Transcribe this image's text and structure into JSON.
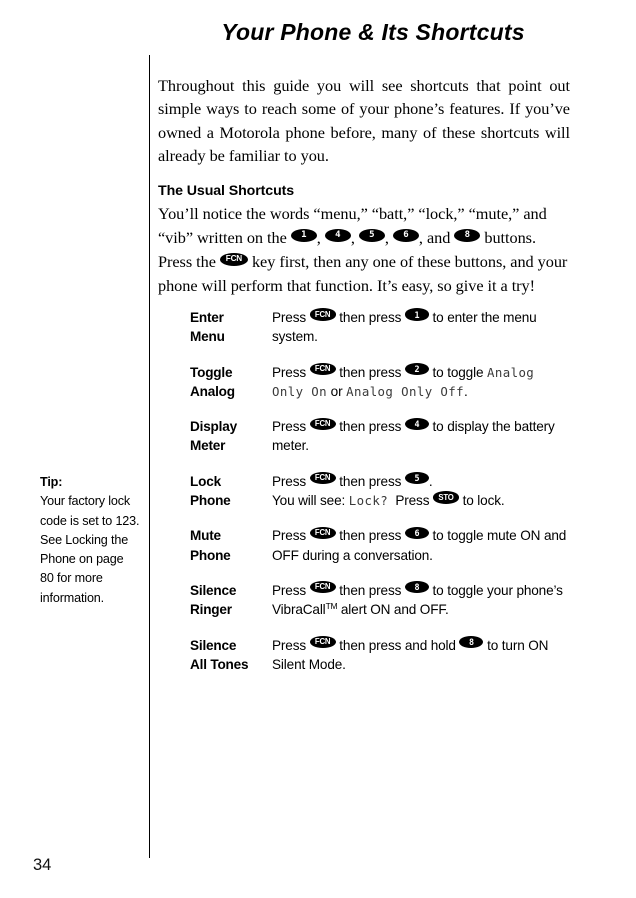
{
  "document": {
    "page_number": "34",
    "title": "Your Phone & Its Shortcuts"
  },
  "intro": {
    "paragraph": "Throughout this guide you will see shortcuts that point out simple ways to reach some of your phone’s features. If you’ve owned a Motorola phone before, many of these shortcuts will already be familiar to you."
  },
  "usual_shortcuts": {
    "heading": "The Usual Shortcuts",
    "text_part_1": "You’ll notice the words “menu,” “batt,” “lock,” “mute,” and “vib” written on the ",
    "key_1": "1",
    "sep_1": ", ",
    "key_4": "4",
    "sep_2": ", ",
    "key_5": "5",
    "sep_3": ", ",
    "key_6": "6",
    "sep_4": ", and ",
    "key_8": "8",
    "text_part_2": " buttons. Press the ",
    "key_fcn": "FCN",
    "text_part_3": " key first, then any one of these buttons, and your phone will perform that function. It’s easy, so give it a try!"
  },
  "shortcuts": [
    {
      "label_line_1": "Enter",
      "label_line_2": "Menu",
      "press_word": "Press",
      "key_fcn": "FCN",
      "then_press": "then press",
      "key_num": "1",
      "tail": "to enter the menu system."
    },
    {
      "label_line_1": "Toggle",
      "label_line_2": "Analog",
      "press_word": "Press",
      "key_fcn": "FCN",
      "then_press": "then press",
      "key_num": "2",
      "tail": "to toggle",
      "lcd_1": "Analog Only On",
      "conjunction": "or",
      "lcd_2": "Analog Only Off",
      "period": "."
    },
    {
      "label_line_1": "Display",
      "label_line_2": "Meter",
      "press_word": "Press",
      "key_fcn": "FCN",
      "then_press": "then press",
      "key_num": "4",
      "tail": "to display the battery meter."
    },
    {
      "label_line_1": "Lock",
      "label_line_2": "Phone",
      "press_word": "Press",
      "key_fcn": "FCN",
      "then_press": "then press",
      "key_num": "5",
      "tail": ".",
      "second_line_prefix": "You will see:",
      "lcd_1": "Lock?",
      "second_line_mid": "Press",
      "key_sto": "STO",
      "second_line_tail": "to lock."
    },
    {
      "label_line_1": "Mute",
      "label_line_2": "Phone",
      "press_word": "Press",
      "key_fcn": "FCN",
      "then_press": "then press",
      "key_num": "6",
      "tail": "to toggle mute ON and OFF during a conversation."
    },
    {
      "label_line_1": "Silence",
      "label_line_2": "Ringer",
      "press_word": "Press",
      "key_fcn": "FCN",
      "then_press": "then press",
      "key_num": "8",
      "tail_a": "to toggle your phone’s VibraCall",
      "trademark": "TM",
      "tail_b": " alert ON and OFF."
    },
    {
      "label_line_1": "Silence",
      "label_line_2": "All Tones",
      "press_word": "Press",
      "key_fcn": "FCN",
      "then_press": "then press and hold",
      "key_num": "8",
      "tail": "to turn ON Silent Mode."
    }
  ],
  "tip": {
    "heading": "Tip:",
    "body": "Your factory lock code is set to 123. See Locking the Phone on page 80 for more information."
  },
  "colors": {
    "page_background": "#ffffff",
    "ink": "#000000",
    "lcd_text": "#3a3a3a"
  }
}
